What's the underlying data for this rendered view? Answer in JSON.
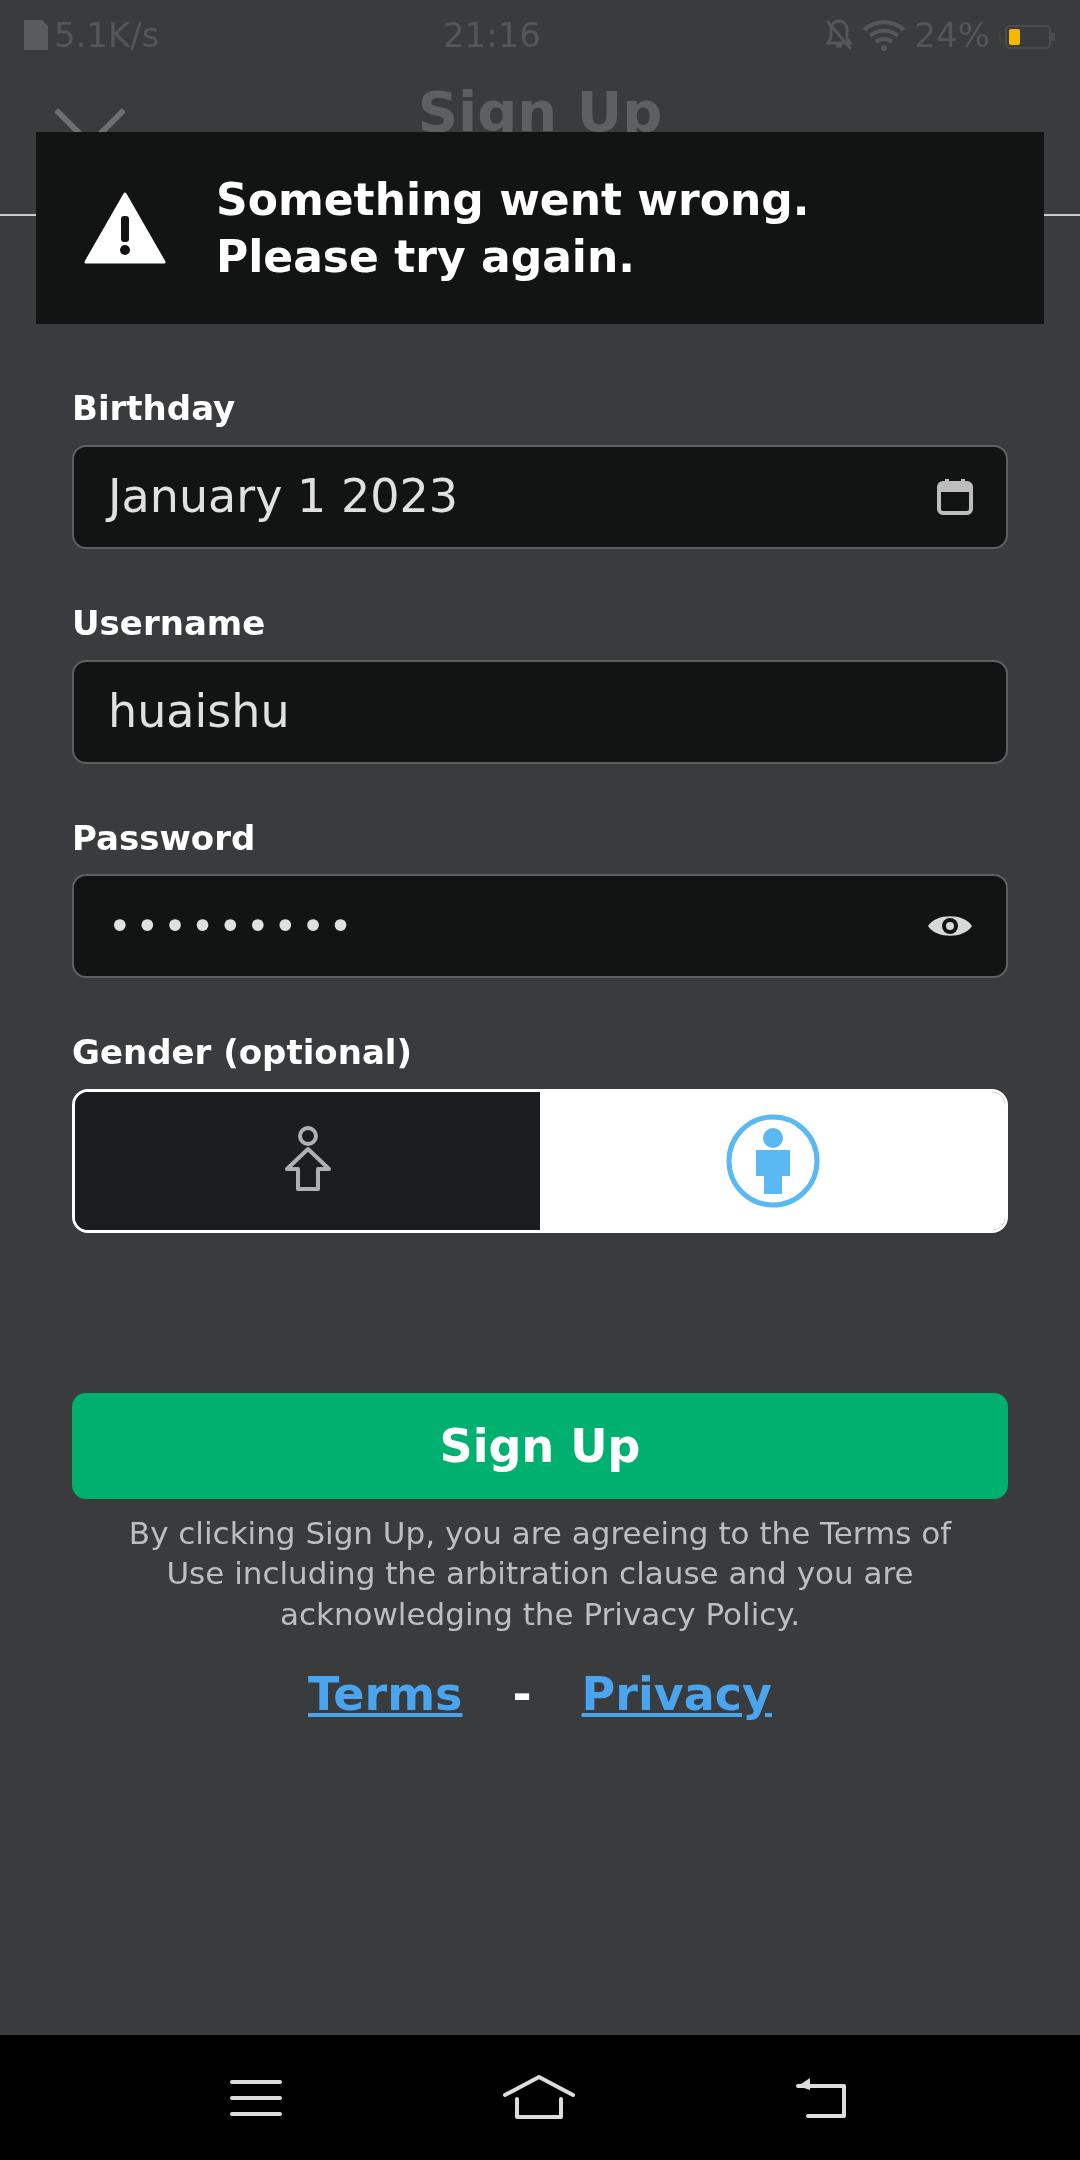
{
  "status_bar": {
    "network_speed": "5.1K/s",
    "time": "21:16",
    "battery": "24%"
  },
  "header": {
    "title": "Sign Up"
  },
  "toast": {
    "message": "Something went wrong.\nPlease try again."
  },
  "fields": [
    {
      "label": "Birthday",
      "value": "January 1 2023",
      "kind": "date"
    },
    {
      "label": "Username",
      "value": "huaishu",
      "kind": "text"
    },
    {
      "label": "Password",
      "value": "•••••••••",
      "kind": "password"
    }
  ],
  "gender": {
    "label": "Gender (optional)",
    "options": [
      {
        "selected": false
      },
      {
        "selected": true
      }
    ]
  },
  "submit": {
    "label": "Sign Up"
  },
  "disclaimer": "By clicking Sign Up, you are agreeing to the Terms of Use including the arbitration clause and you are acknowledging the Privacy Policy.",
  "links": [
    {
      "label": "Terms"
    },
    {
      "label": "Privacy"
    }
  ],
  "link_separator": "-"
}
